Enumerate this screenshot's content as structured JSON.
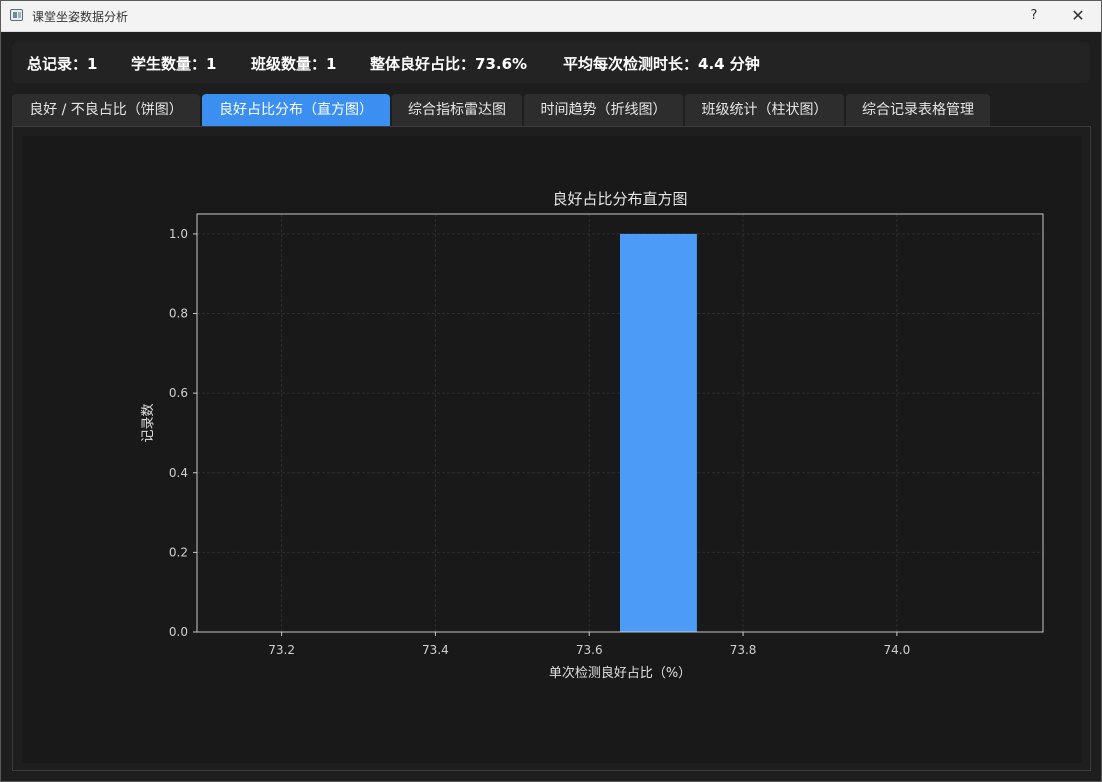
{
  "window": {
    "title": "课堂坐姿数据分析",
    "help_label": "?",
    "close_label": "✕",
    "app_icon": "app-window-icon"
  },
  "stats": {
    "total_records": "总记录：1",
    "student_count": "学生数量：1",
    "class_count": "班级数量：1",
    "overall_good_ratio": "整体良好占比：73.6%",
    "avg_duration": "平均每次检测时长：4.4 分钟"
  },
  "tabs": [
    {
      "label": "良好 / 不良占比（饼图）",
      "active": false
    },
    {
      "label": "良好占比分布（直方图）",
      "active": true
    },
    {
      "label": "综合指标雷达图",
      "active": false
    },
    {
      "label": "时间趋势（折线图）",
      "active": false
    },
    {
      "label": "班级统计（柱状图）",
      "active": false
    },
    {
      "label": "综合记录表格管理",
      "active": false
    }
  ],
  "chart_data": {
    "type": "bar",
    "title": "良好占比分布直方图",
    "xlabel": "单次检测良好占比（%）",
    "ylabel": "记录数",
    "xlim": [
      73.09,
      74.19
    ],
    "ylim": [
      0,
      1.05
    ],
    "x_ticks": [
      "73.2",
      "73.4",
      "73.6",
      "73.8",
      "74.0"
    ],
    "y_ticks": [
      "0.0",
      "0.2",
      "0.4",
      "0.6",
      "0.8",
      "1.0"
    ],
    "bins": [
      {
        "x0": 73.64,
        "x1": 73.74,
        "count": 1
      }
    ],
    "bar_color": "#4c9bf7",
    "grid": true
  }
}
